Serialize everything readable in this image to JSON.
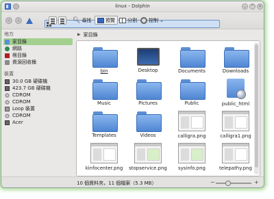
{
  "window": {
    "title": "linux - Dolphin"
  },
  "toolbar": {
    "find_label": "尋找",
    "preview_label": "預覽",
    "split_label": "分割",
    "control_label": "控制",
    "control_dropdown": "⌄"
  },
  "sidebar": {
    "places_heading": "地方",
    "places": [
      {
        "label": "家目錄",
        "icon": "home-folder-icon",
        "selected": true
      },
      {
        "label": "網路",
        "icon": "network-icon"
      },
      {
        "label": "根目錄",
        "icon": "root-folder-icon"
      },
      {
        "label": "資源回收桶",
        "icon": "trash-icon"
      }
    ],
    "devices_heading": "裝置",
    "devices": [
      {
        "label": "30.0 GB 硬碟機",
        "icon": "hard-drive-icon"
      },
      {
        "label": "423.7 GB 硬碟機",
        "icon": "hard-drive-icon"
      },
      {
        "label": "CDROM",
        "icon": "cdrom-icon"
      },
      {
        "label": "CDROM",
        "icon": "cdrom-icon"
      },
      {
        "label": "Loop 裝置",
        "icon": "loop-device-icon"
      },
      {
        "label": "CDROM",
        "icon": "cdrom-icon"
      },
      {
        "label": "Acer",
        "icon": "drive-icon"
      }
    ]
  },
  "location": {
    "current": "家目錄"
  },
  "files": [
    {
      "name": "bin",
      "kind": "folder",
      "underline": true
    },
    {
      "name": "Desktop",
      "kind": "desktop"
    },
    {
      "name": "Documents",
      "kind": "folder"
    },
    {
      "name": "Downloads",
      "kind": "folder"
    },
    {
      "name": "Music",
      "kind": "folder"
    },
    {
      "name": "Pictures",
      "kind": "folder"
    },
    {
      "name": "Public",
      "kind": "folder"
    },
    {
      "name": "public_html",
      "kind": "html"
    },
    {
      "name": "Templates",
      "kind": "folder"
    },
    {
      "name": "Videos",
      "kind": "folder"
    },
    {
      "name": "calligra.png",
      "kind": "image"
    },
    {
      "name": "calligra1.png",
      "kind": "image"
    },
    {
      "name": "kinfocenter.png",
      "kind": "image"
    },
    {
      "name": "stopservice.png",
      "kind": "image-green"
    },
    {
      "name": "sysinfo.png",
      "kind": "image-green"
    },
    {
      "name": "telepathy.png",
      "kind": "image"
    }
  ],
  "status": {
    "text": "10 個資料夾，11 個檔案（5.3 MB）",
    "zoom_level": 0.35
  },
  "colors": {
    "selection": "#a3d08e",
    "folder": "#5b8fd6",
    "glow": "#b8e0a8"
  }
}
